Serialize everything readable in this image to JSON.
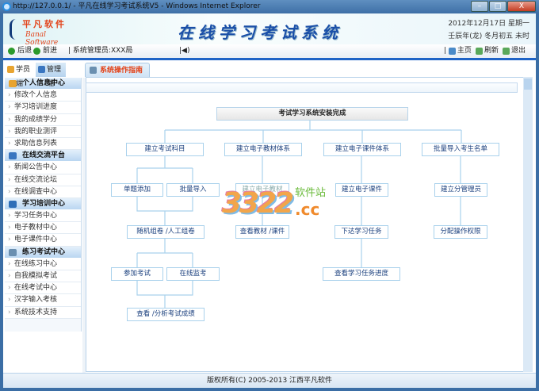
{
  "window": {
    "title": "http://127.0.0.1/ - 平凡在线学习考试系统V5 - Windows Internet Explorer"
  },
  "header": {
    "logo_cn": "平凡软件",
    "logo_en": "Banal Software",
    "app_title": "在线学习考试系统",
    "date": "2012年12月17日 星期一",
    "lunar": "壬辰年(龙) 冬月初五 未时"
  },
  "toolbar": {
    "back": "后退",
    "forward": "前进",
    "user": "系统管理员:XXX局",
    "home": "主页",
    "refresh": "刷新",
    "logout": "退出"
  },
  "side_tabs": [
    "学员端",
    "管理端"
  ],
  "main_tab": "系统操作指南",
  "sidebar": [
    {
      "title": "个人信息中心",
      "items": [
        "修改个人信息",
        "学习培训进度",
        "我的成绩学分",
        "我的职业测评",
        "求助信息列表"
      ]
    },
    {
      "title": "在线交流平台",
      "items": [
        "新闻公告中心",
        "在线交流论坛",
        "在线调查中心"
      ]
    },
    {
      "title": "学习培训中心",
      "items": [
        "学习任务中心",
        "电子教材中心",
        "电子课件中心"
      ]
    },
    {
      "title": "练习考试中心",
      "items": [
        "在线练习中心",
        "自我模拟考试",
        "在线考试中心",
        "汉字输入考核",
        "系统技术支持"
      ]
    }
  ],
  "flow": {
    "root": "考试学习系统安装完成",
    "c1": "建立考试科目",
    "c2": "建立电子教材体系",
    "c3": "建立电子课件体系",
    "c4": "批量导入考生名单",
    "single_add": "单题添加",
    "batch_import": "批量导入",
    "create_textbook": "建立电子教材",
    "create_courseware": "建立电子课件",
    "create_admin": "建立分管理员",
    "compose_paper": "随机组卷 /人工组卷",
    "view_materials": "查看教材 /课件",
    "assign_task": "下达学习任务",
    "assign_perm": "分配操作权限",
    "take_exam": "参加考试",
    "monitor": "在线监考",
    "view_progress": "查看学习任务进度",
    "analyze": "查看 /分析考试成绩"
  },
  "watermark": {
    "num": "3322",
    "cc": ".cc",
    "zh": "软件站"
  },
  "footer": "版权所有(C) 2005-2013 江西平凡软件"
}
